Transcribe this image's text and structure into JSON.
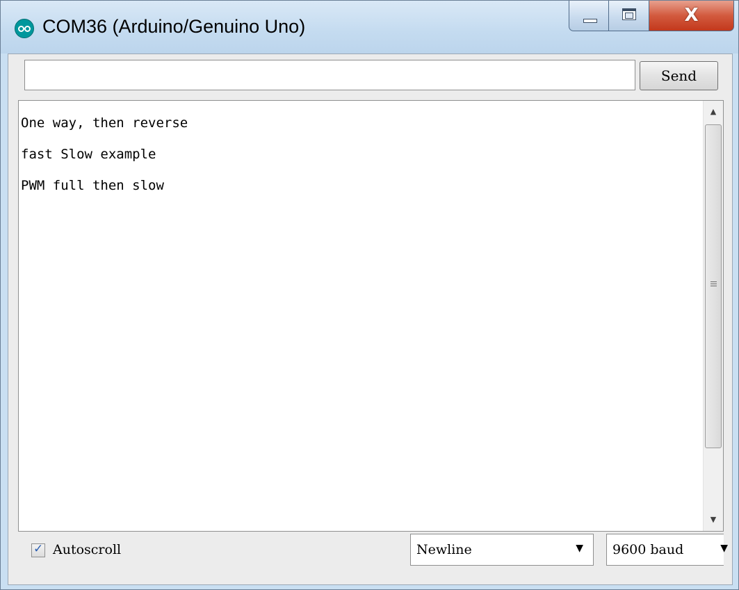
{
  "window": {
    "title": "COM36 (Arduino/Genuino Uno)",
    "icon": "arduino-logo-icon",
    "caption_buttons": [
      "minimize",
      "maximize",
      "close"
    ],
    "close_glyph": "X"
  },
  "send_bar": {
    "input_value": "",
    "send_label": "Send"
  },
  "output": {
    "lines": [
      "One way, then reverse",
      "fast Slow example",
      "PWM full then slow"
    ]
  },
  "bottom": {
    "autoscroll_label": "Autoscroll",
    "autoscroll_checked": true,
    "line_ending": "Newline",
    "baud_rate": "9600 baud"
  },
  "colors": {
    "titlebar": "#c4dbf0",
    "close_button": "#c3381c",
    "arduino_teal": "#00979c"
  }
}
